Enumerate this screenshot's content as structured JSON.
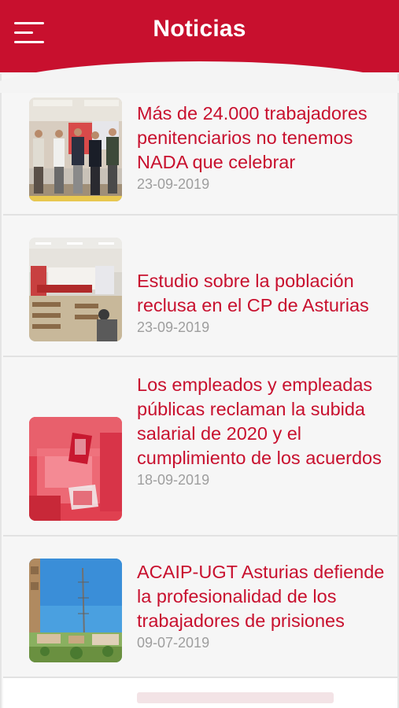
{
  "header": {
    "title": "Noticias",
    "menu_icon": "hamburger-menu-icon",
    "color": "#c8102e"
  },
  "news": [
    {
      "headline": "Más de 24.000 trabajadores penitenciarios no tenemos NADA que celebrar",
      "date": "23-09-2019",
      "thumbnail": "group-photo"
    },
    {
      "headline": "Estudio sobre la población reclusa en el CP de Asturias",
      "date": "23-09-2019",
      "thumbnail": "meeting-room-photo"
    },
    {
      "headline": "Los empleados y empleadas públicas reclaman la subida salarial de 2020 y el cumplimiento de los acuerdos",
      "date": "18-09-2019",
      "thumbnail": "ballot-box-photo"
    },
    {
      "headline": "ACAIP-UGT Asturias defiende la profesionalidad de los trabajadores de prisiones",
      "date": "09-07-2019",
      "thumbnail": "tower-sky-photo"
    }
  ],
  "colors": {
    "accent": "#c8102e",
    "date": "#9e9e9e",
    "background": "#f6f6f6"
  }
}
